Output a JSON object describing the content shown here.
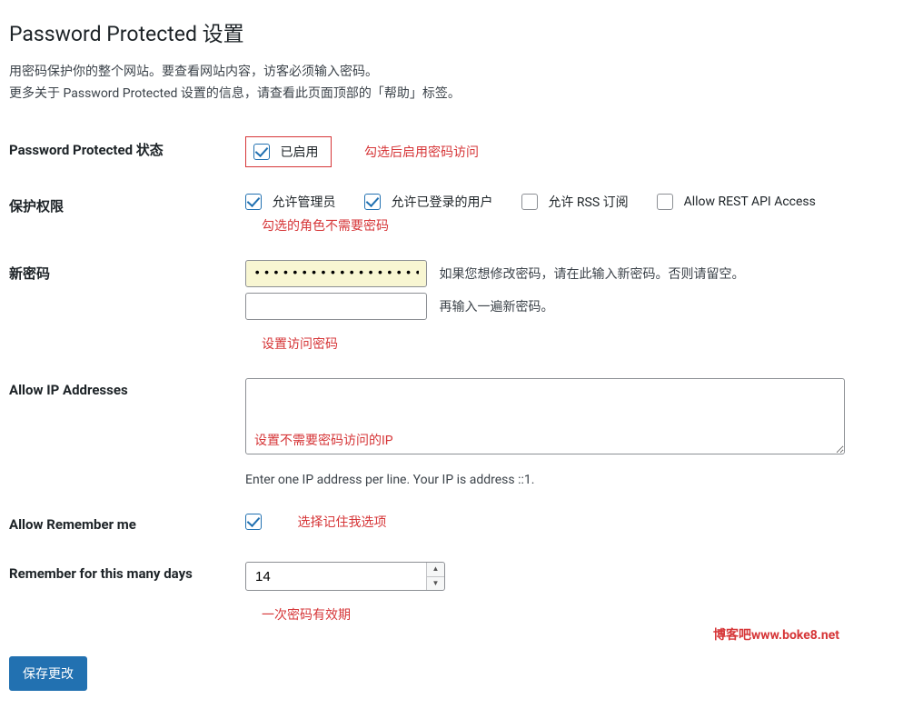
{
  "page": {
    "title": "Password Protected 设置",
    "desc1": "用密码保护你的整个网站。要查看网站内容，访客必须输入密码。",
    "desc2": "更多关于 Password Protected 设置的信息，请查看此页面顶部的「帮助」标签。"
  },
  "status": {
    "label": "Password Protected 状态",
    "enabled_label": "已启用",
    "note": "勾选后启用密码访问"
  },
  "perm": {
    "label": "保护权限",
    "opt_admin": "允许管理员",
    "opt_loggedin": "允许已登录的用户",
    "opt_rss": "允许 RSS 订阅",
    "opt_rest": "Allow REST API Access",
    "note": "勾选的角色不需要密码"
  },
  "newpw": {
    "label": "新密码",
    "value": "••••••••••••••••••",
    "after1": "如果您想修改密码，请在此输入新密码。否则请留空。",
    "after2": "再输入一遍新密码。",
    "note": "设置访问密码"
  },
  "ip": {
    "label": "Allow IP Addresses",
    "note": "设置不需要密码访问的IP",
    "hint": "Enter one IP address per line. Your IP is address ::1."
  },
  "remember": {
    "label": "Allow Remember me",
    "note": "选择记住我选项"
  },
  "days": {
    "label": "Remember for this many days",
    "value": "14",
    "note": "一次密码有效期"
  },
  "save_label": "保存更改",
  "watermark": "博客吧www.boke8.net"
}
